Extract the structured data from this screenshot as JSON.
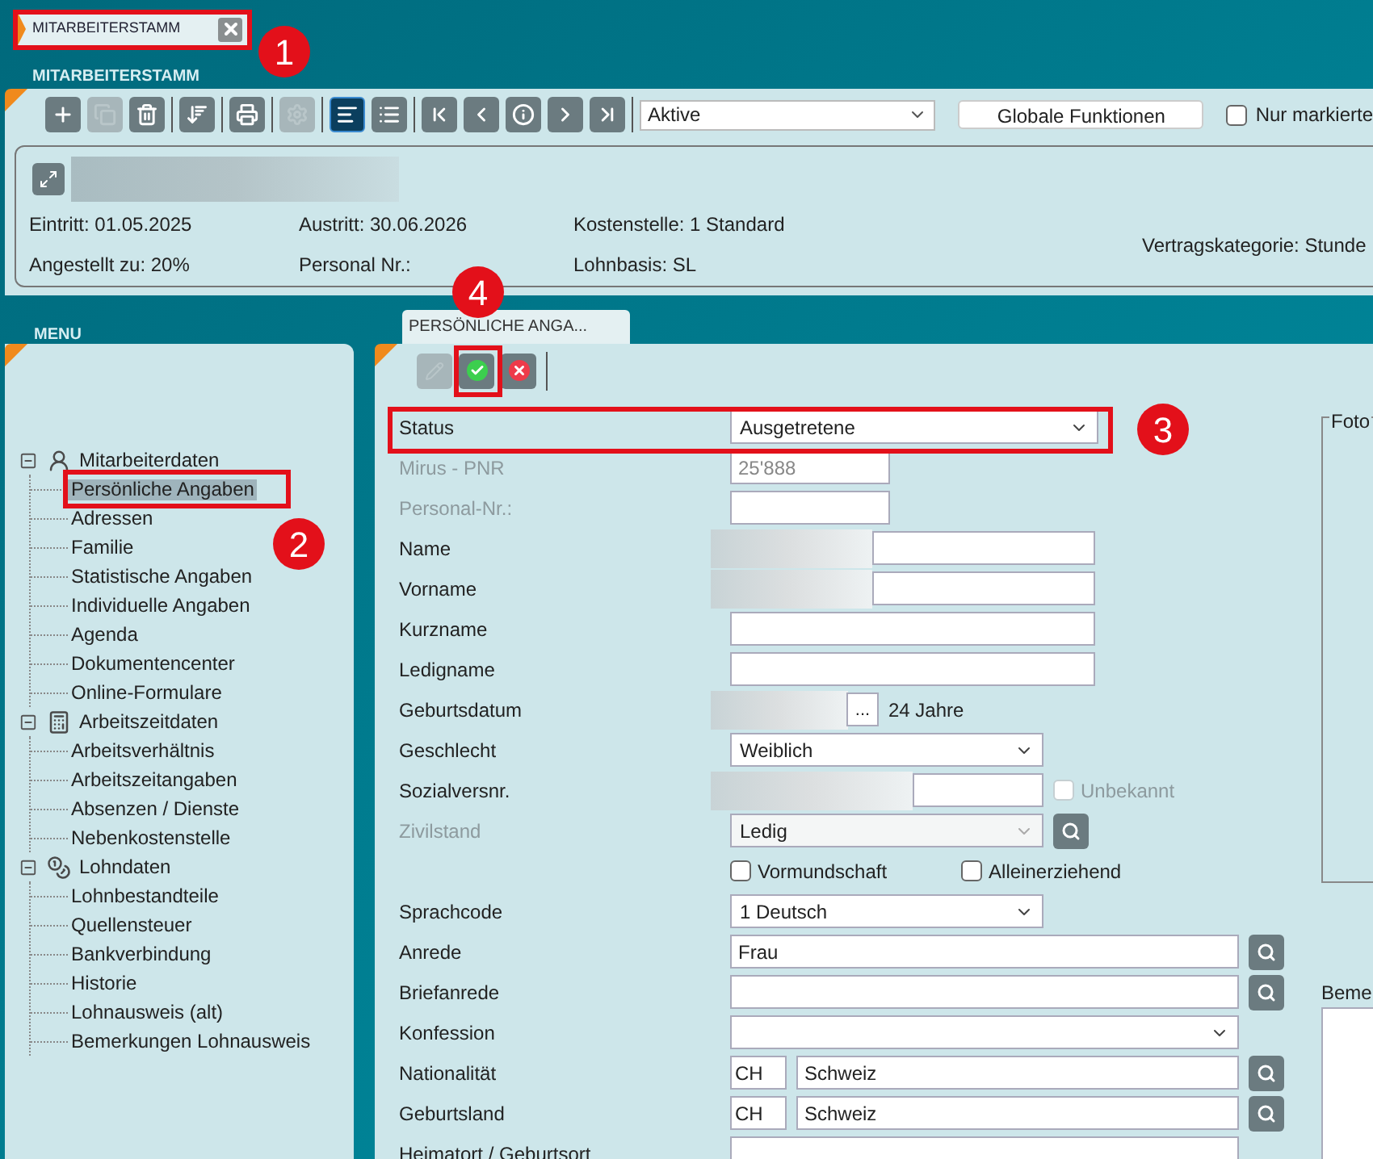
{
  "document_tab": {
    "title": "MITARBEITERSTAMM"
  },
  "section_title": "MITARBEITERSTAMM",
  "toolbar": {
    "groups": [
      [
        {
          "kind": "add",
          "disabled": false,
          "selected": false
        },
        {
          "kind": "copy",
          "disabled": true,
          "selected": false
        },
        {
          "kind": "delete",
          "disabled": false,
          "selected": false
        }
      ],
      [
        {
          "kind": "sort",
          "disabled": false,
          "selected": false
        }
      ],
      [
        {
          "kind": "print",
          "disabled": false,
          "selected": false
        }
      ],
      [
        {
          "kind": "settings",
          "disabled": true,
          "selected": false
        }
      ],
      [
        {
          "kind": "detail",
          "disabled": false,
          "selected": true
        },
        {
          "kind": "list",
          "disabled": false,
          "selected": false
        }
      ],
      [
        {
          "kind": "first",
          "disabled": false,
          "selected": false
        },
        {
          "kind": "previous",
          "disabled": false,
          "selected": false
        },
        {
          "kind": "info",
          "disabled": false,
          "selected": false
        },
        {
          "kind": "next",
          "disabled": false,
          "selected": false
        },
        {
          "kind": "last",
          "disabled": false,
          "selected": false
        }
      ]
    ]
  },
  "filter": {
    "value": "Aktive"
  },
  "global_button": "Globale Funktionen",
  "marked_only": {
    "label": "Nur markierte",
    "checked": false
  },
  "summary": {
    "columns": [
      [
        "Eintritt: 01.05.2025",
        "Angestellt zu: 20%"
      ],
      [
        "Austritt: 30.06.2026",
        "Personal Nr.:"
      ],
      [
        "Kostenstelle: 1 Standard",
        "Lohnbasis: SL"
      ],
      [
        "Vertragskategorie: Stunde"
      ]
    ]
  },
  "menu": {
    "title": "MENU",
    "tree": [
      {
        "label": "Mitarbeiterdaten",
        "kind": "person",
        "expanded": true,
        "selected": false,
        "children": [
          {
            "label": "Persönliche Angaben",
            "selected": true
          },
          {
            "label": "Adressen",
            "selected": false
          },
          {
            "label": "Familie",
            "selected": false
          },
          {
            "label": "Statistische Angaben",
            "selected": false
          },
          {
            "label": "Individuelle Angaben",
            "selected": false
          },
          {
            "label": "Agenda",
            "selected": false
          },
          {
            "label": "Dokumentencenter",
            "selected": false
          },
          {
            "label": "Online-Formulare",
            "selected": false
          }
        ]
      },
      {
        "label": "Arbeitszeitdaten",
        "kind": "timesheet",
        "expanded": true,
        "selected": false,
        "children": [
          {
            "label": "Arbeitsverhältnis",
            "selected": false
          },
          {
            "label": "Arbeitszeitangaben",
            "selected": false
          },
          {
            "label": "Absenzen / Dienste",
            "selected": false
          },
          {
            "label": "Nebenkostenstelle",
            "selected": false
          }
        ]
      },
      {
        "label": "Lohndaten",
        "kind": "payroll",
        "expanded": true,
        "selected": false,
        "children": [
          {
            "label": "Lohnbestandteile",
            "selected": false
          },
          {
            "label": "Quellensteuer",
            "selected": false
          },
          {
            "label": "Bankverbindung",
            "selected": false
          },
          {
            "label": "Historie",
            "selected": false
          },
          {
            "label": "Lohnausweis (alt)",
            "selected": false
          },
          {
            "label": "Bemerkungen Lohnausweis",
            "selected": false
          }
        ]
      }
    ]
  },
  "detail_tab": {
    "title": "PERSÖNLICHE ANGA..."
  },
  "detail_toolbar": [
    {
      "kind": "edit",
      "disabled": true
    },
    {
      "kind": "save",
      "disabled": false
    },
    {
      "kind": "cancel",
      "disabled": false
    }
  ],
  "form": {
    "rows": [
      {
        "kind": "select",
        "label": "Status",
        "value": "Ausgetretene"
      },
      {
        "kind": "input",
        "label": "Mirus - PNR",
        "value": "25'888",
        "disabled": true
      },
      {
        "kind": "input",
        "label": "Personal-Nr.:",
        "disabled": true
      },
      {
        "kind": "input",
        "label": "Name",
        "blurred": true
      },
      {
        "kind": "input",
        "label": "Vorname",
        "blurred": true
      },
      {
        "kind": "input",
        "label": "Kurzname"
      },
      {
        "kind": "input",
        "label": "Ledigname"
      },
      {
        "kind": "date",
        "label": "Geburtsdatum",
        "button": "...",
        "note": "24 Jahre",
        "blurred": true
      },
      {
        "kind": "select",
        "label": "Geschlecht",
        "value": "Weiblich"
      },
      {
        "kind": "input",
        "label": "Sozialversnr.",
        "blurred": true,
        "option": {
          "label": "Unbekannt",
          "checked": false,
          "disabled": true
        }
      },
      {
        "kind": "select",
        "label": "Zivilstand",
        "value": "Ledig",
        "disabled": true,
        "search": true
      },
      {
        "kind": "checkboxes",
        "options": [
          {
            "label": "Vormundschaft",
            "checked": false
          },
          {
            "label": "Alleinerziehend",
            "checked": false
          }
        ]
      },
      {
        "kind": "select",
        "label": "Sprachcode",
        "value": "1 Deutsch"
      },
      {
        "kind": "input",
        "label": "Anrede",
        "value": "Frau",
        "search": true
      },
      {
        "kind": "input",
        "label": "Briefanrede",
        "search": true
      },
      {
        "kind": "select",
        "label": "Konfession"
      },
      {
        "kind": "country",
        "label": "Nationalität",
        "code": "CH",
        "value": "Schweiz",
        "search": true
      },
      {
        "kind": "country",
        "label": "Geburtsland",
        "code": "CH",
        "value": "Schweiz",
        "search": true
      },
      {
        "kind": "input",
        "label": "Heimatort / Geburtsort"
      }
    ]
  },
  "photo": {
    "label": "Foto"
  },
  "remarks": {
    "label": "Beme"
  },
  "annotations": [
    {
      "label": "1"
    },
    {
      "label": "2"
    },
    {
      "label": "3"
    },
    {
      "label": "4"
    }
  ]
}
